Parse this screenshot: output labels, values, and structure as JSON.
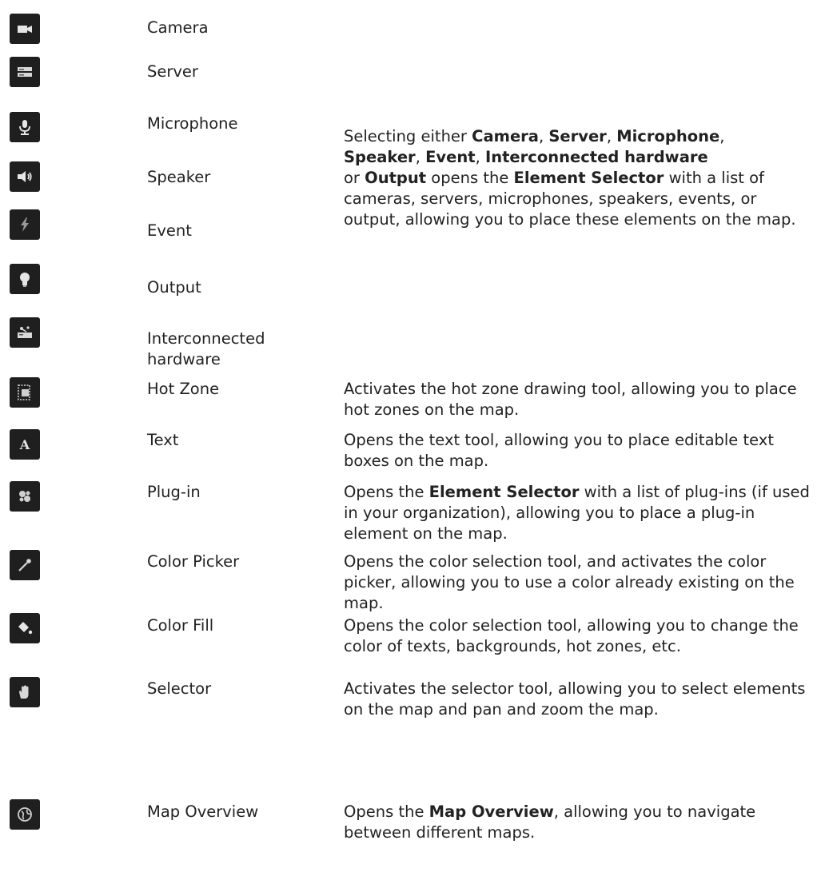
{
  "rows": {
    "camera": {
      "icon": "camera-icon",
      "label": "Camera"
    },
    "server": {
      "icon": "server-icon",
      "label": "Server"
    },
    "microphone": {
      "icon": "microphone-icon",
      "label": "Microphone"
    },
    "speaker": {
      "icon": "speaker-icon",
      "label": "Speaker"
    },
    "event": {
      "icon": "lightning-icon",
      "label": "Event"
    },
    "output": {
      "icon": "lightbulb-icon",
      "label": "Output"
    },
    "interconnected": {
      "icon": "interconnected-hardware-icon",
      "label_line1": "Interconnected",
      "label_line2": "hardware"
    },
    "hotzone": {
      "icon": "hot-zone-icon",
      "label": "Hot Zone"
    },
    "text": {
      "icon": "text-icon",
      "label": "Text"
    },
    "plugin": {
      "icon": "puzzle-icon",
      "label": "Plug-in"
    },
    "colorpicker": {
      "icon": "eyedropper-icon",
      "label": "Color Picker"
    },
    "colorfill": {
      "icon": "paint-bucket-icon",
      "label": "Color Fill"
    },
    "selector": {
      "icon": "hand-icon",
      "label": "Selector"
    },
    "mapoverview": {
      "icon": "globe-icon",
      "label": "Map Overview"
    }
  },
  "descriptions": {
    "element_group": {
      "p1": "Selecting either ",
      "b1": "Camera",
      "p2": ", ",
      "b2": "Server",
      "p3": ", ",
      "b3": "Microphone",
      "p4": ",",
      "b4": "Speaker",
      "p5": ", ",
      "b5": "Event",
      "p6": ", ",
      "b6": "Interconnected hardware",
      "p7": "or ",
      "b7": "Output",
      "p8": " opens the ",
      "b8": "Element Selector",
      "p9": " with a list of cameras, servers, microphones, speakers, events, or output, allowing you to place these elements on the map."
    },
    "hotzone": "Activates the hot zone drawing tool, allowing you to place hot zones on the map.",
    "text": "Opens the text tool, allowing you to place editable text boxes on the map.",
    "plugin": {
      "p1": "Opens the ",
      "b1": "Element Selector",
      "p2": " with a list of plug-ins (if used in your organization), allowing you to place a plug-in element on the map."
    },
    "colorpicker": "Opens the color selection tool, and activates the color picker, allowing you to use a color already existing on the map.",
    "colorfill": "Opens the color selection tool, allowing you to change the color of texts, backgrounds, hot zones, etc.",
    "selector": "Activates the selector tool, allowing you to select elements on the map and pan and zoom the map.",
    "mapoverview": {
      "p1": "Opens the ",
      "b1": "Map Overview",
      "p2": ", allowing you to navigate between different maps."
    }
  }
}
